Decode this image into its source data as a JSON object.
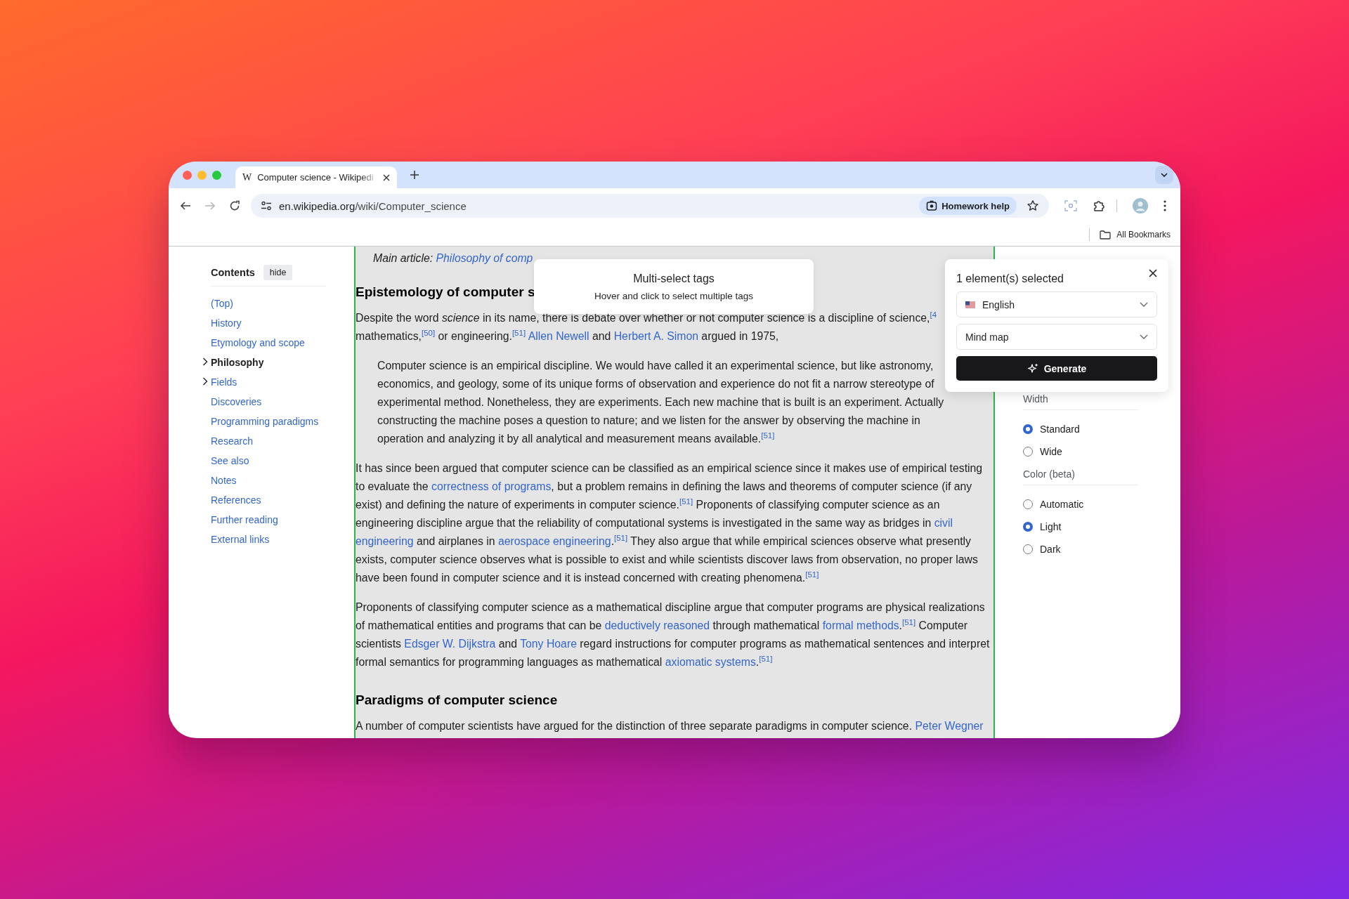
{
  "browser": {
    "tab": {
      "favicon": "W",
      "title": "Computer science - Wikipedi"
    },
    "nav": {
      "back_disabled": false,
      "forward_disabled": true
    },
    "url": {
      "host": "en.wikipedia.org",
      "path": "/wiki/Computer_science"
    },
    "homework_chip": "Homework help",
    "bookmarks": "All Bookmarks"
  },
  "toc": {
    "title": "Contents",
    "hide": "hide",
    "items": [
      {
        "label": "(Top)",
        "selected": false,
        "expandable": false
      },
      {
        "label": "History",
        "selected": false,
        "expandable": false
      },
      {
        "label": "Etymology and scope",
        "selected": false,
        "expandable": false
      },
      {
        "label": "Philosophy",
        "selected": true,
        "expandable": true
      },
      {
        "label": "Fields",
        "selected": false,
        "expandable": true
      },
      {
        "label": "Discoveries",
        "selected": false,
        "expandable": false
      },
      {
        "label": "Programming paradigms",
        "selected": false,
        "expandable": false
      },
      {
        "label": "Research",
        "selected": false,
        "expandable": false
      },
      {
        "label": "See also",
        "selected": false,
        "expandable": false
      },
      {
        "label": "Notes",
        "selected": false,
        "expandable": false
      },
      {
        "label": "References",
        "selected": false,
        "expandable": false
      },
      {
        "label": "Further reading",
        "selected": false,
        "expandable": false
      },
      {
        "label": "External links",
        "selected": false,
        "expandable": false
      }
    ]
  },
  "article": {
    "blocks": [
      {
        "kind": "hatnote",
        "segments": [
          {
            "kind": "text",
            "text": "Main article: "
          },
          {
            "kind": "link",
            "text": "Philosophy of comp"
          }
        ]
      },
      {
        "kind": "heading",
        "text": "Epistemology of computer s"
      },
      {
        "kind": "paragraph",
        "segments": [
          {
            "kind": "text",
            "text": "Despite the word *science* in its name, there is debate over whether or not computer science is a discipline of science,$^{[4}$ mathematics,$^{[50]}$ or engineering.$^{[51]}$ "
          },
          {
            "kind": "link",
            "text": "Allen Newell"
          },
          {
            "kind": "text",
            "text": " and "
          },
          {
            "kind": "link",
            "text": "Herbert A. Simon"
          },
          {
            "kind": "text",
            "text": " argued in 1975,"
          }
        ]
      },
      {
        "kind": "quote",
        "segments": [
          {
            "kind": "text",
            "text": "Computer science is an empirical discipline. We would have called it an experimental science, but like astronomy, economics, and geology, some of its unique forms of observation and experience do not fit a narrow stereotype of experimental method. Nonetheless, they are experiments. Each new machine that is built is an experiment. Actually constructing the machine poses a question to nature; and we listen for the answer by observing the machine in operation and analyzing it by all analytical and measurement means available.$^{[51]}$"
          }
        ]
      },
      {
        "kind": "paragraph",
        "segments": [
          {
            "kind": "text",
            "text": "It has since been argued that computer science can be classified as an empirical science since it makes use of empirical testing to evaluate the "
          },
          {
            "kind": "link",
            "text": "correctness of programs"
          },
          {
            "kind": "text",
            "text": ", but a problem remains in defining the laws and theorems of computer science (if any exist) and defining the nature of experiments in computer science.$^{[51]}$ Proponents of classifying computer science as an engineering discipline argue that the reliability of computational systems is investigated in the same way as bridges in "
          },
          {
            "kind": "link",
            "text": "civil"
          },
          {
            "kind": "link",
            "text": "engineering"
          },
          {
            "kind": "text",
            "text": " and airplanes in "
          },
          {
            "kind": "link",
            "text": "aerospace engineering"
          },
          {
            "kind": "text",
            "text": ".$^{[51]}$ They also argue that while empirical sciences observe what presently exists, computer science observes what is possible to exist and while scientists discover laws from observation, no proper laws have been found in computer science and it is instead concerned with creating phenomena.$^{[51]}$"
          }
        ]
      },
      {
        "kind": "paragraph",
        "segments": [
          {
            "kind": "text",
            "text": "Proponents of classifying computer science as a mathematical discipline argue that computer programs are physical realizations of mathematical entities and programs that can be "
          },
          {
            "kind": "link",
            "text": "deductively reasoned"
          },
          {
            "kind": "text",
            "text": " through mathematical "
          },
          {
            "kind": "link",
            "text": "formal methods"
          },
          {
            "kind": "text",
            "text": ".$^{[51]}$ Computer scientists "
          },
          {
            "kind": "link",
            "text": "Edsger W. Dijkstra"
          },
          {
            "kind": "text",
            "text": " and "
          },
          {
            "kind": "link",
            "text": "Tony Hoare"
          },
          {
            "kind": "text",
            "text": " regard instructions for computer programs as mathematical sentences and interpret formal semantics for programming languages as mathematical "
          },
          {
            "kind": "link",
            "text": "axiomatic systems"
          },
          {
            "kind": "text",
            "text": ".$^{[51]}$"
          }
        ]
      },
      {
        "kind": "heading",
        "text": "Paradigms of computer science"
      },
      {
        "kind": "paragraph",
        "segments": [
          {
            "kind": "text",
            "text": "A number of computer scientists have argued for the distinction of three separate paradigms in computer science. "
          },
          {
            "kind": "link",
            "text": "Peter Wegner"
          }
        ]
      }
    ]
  },
  "appearance": {
    "groups": [
      {
        "title": "Width",
        "options": [
          {
            "label": "Standard",
            "selected": true
          },
          {
            "label": "Wide",
            "selected": false
          }
        ]
      },
      {
        "title": "Color (beta)",
        "options": [
          {
            "label": "Automatic",
            "selected": false
          },
          {
            "label": "Light",
            "selected": true
          },
          {
            "label": "Dark",
            "selected": false
          }
        ]
      }
    ]
  },
  "tooltip": {
    "title": "Multi-select tags",
    "text": "Hover and click to select multiple tags"
  },
  "element_panel": {
    "title": "1 element(s) selected",
    "language": "English",
    "format": "Mind map",
    "button": "Generate"
  }
}
